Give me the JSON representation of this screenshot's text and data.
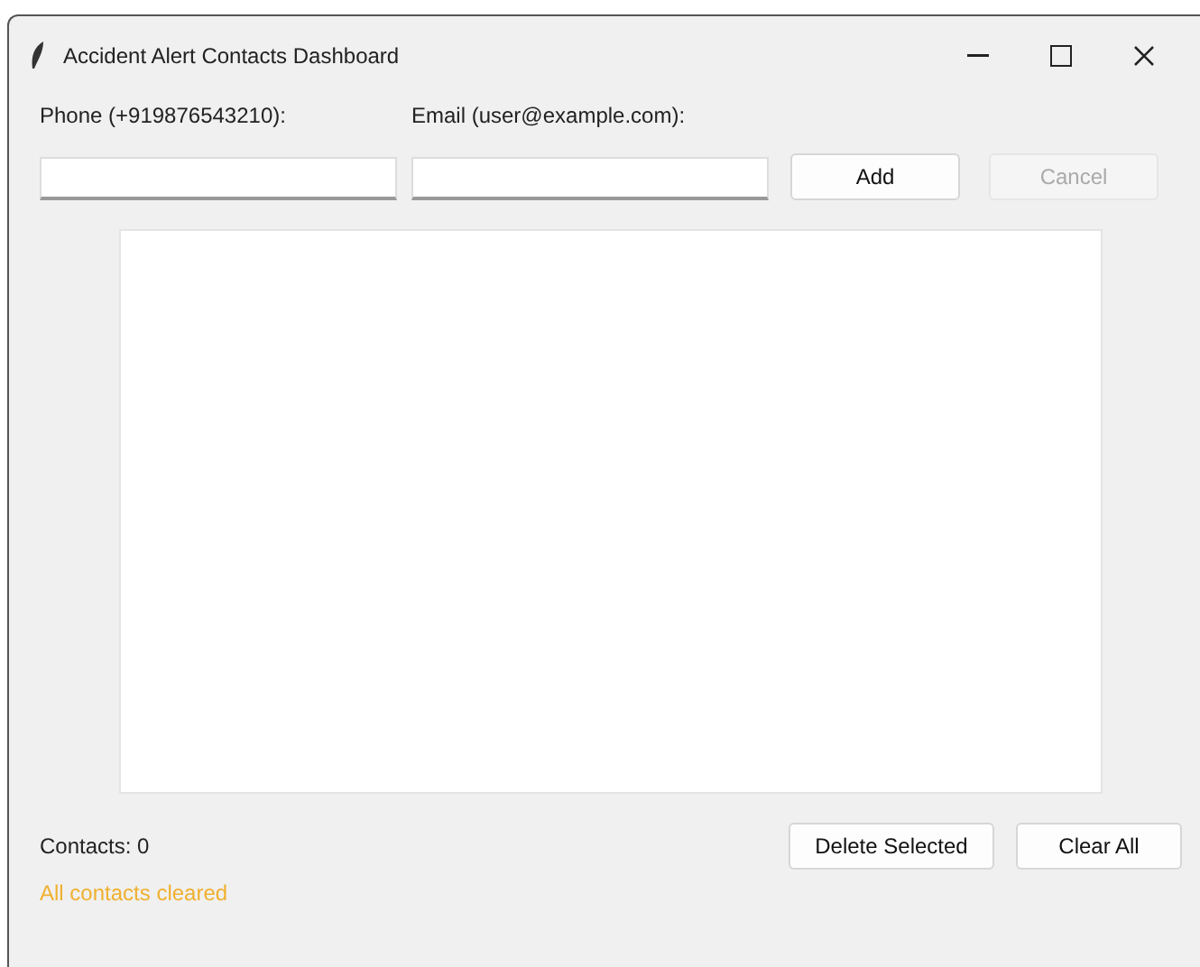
{
  "window": {
    "title": "Accident Alert Contacts Dashboard"
  },
  "fields": [
    {
      "label": "Phone (+919876543210):"
    },
    {
      "label": "Email (user@example.com):"
    }
  ],
  "form_buttons": [
    {
      "label": "Add",
      "disabled": false
    },
    {
      "label": "Cancel",
      "disabled": true
    }
  ],
  "contacts_count": "Contacts: 0",
  "status": {
    "text": "All contacts cleared",
    "color": "#f0b030"
  },
  "list_buttons": [
    {
      "label": "Delete Selected",
      "disabled": false
    },
    {
      "label": "Clear All",
      "disabled": false
    }
  ]
}
